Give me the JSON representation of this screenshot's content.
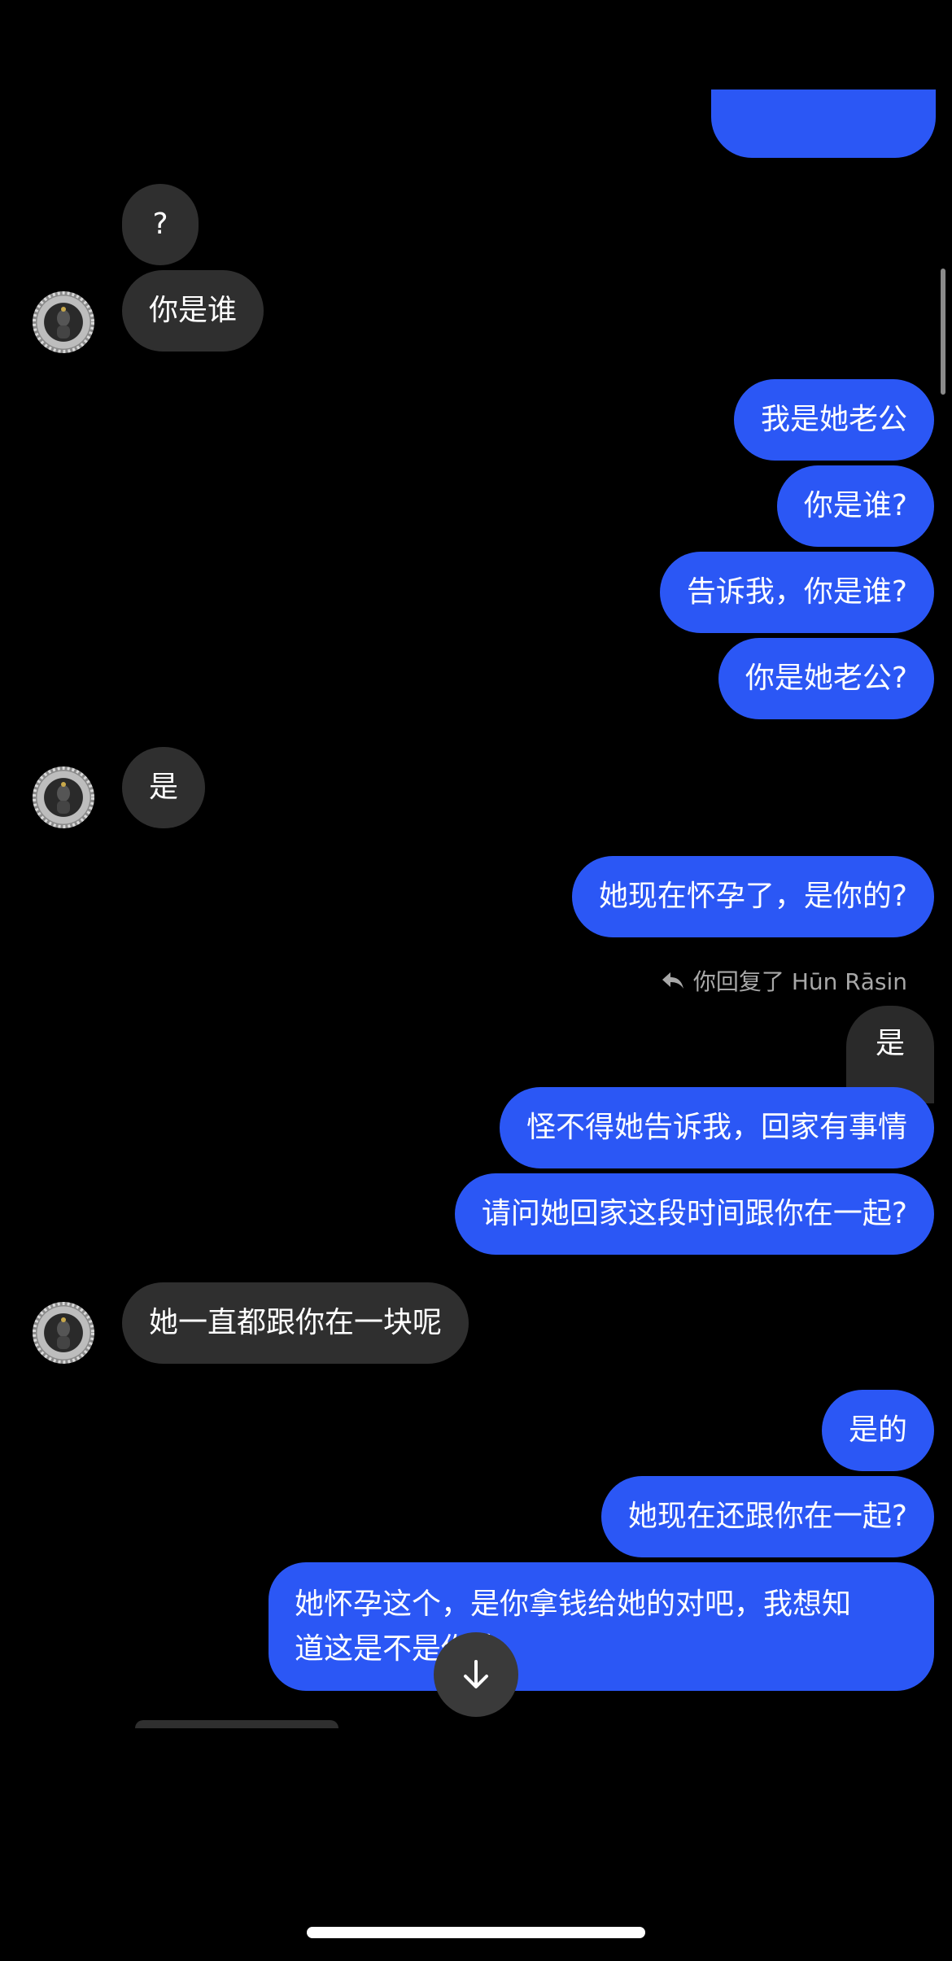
{
  "messages": {
    "m1": {
      "text": "?"
    },
    "m2": {
      "text": "你是谁"
    },
    "m3": {
      "text": "我是她老公"
    },
    "m4": {
      "text": "你是谁?"
    },
    "m5": {
      "text": "告诉我，你是谁?"
    },
    "m6": {
      "text": "你是她老公?"
    },
    "m7": {
      "text": "是"
    },
    "m8": {
      "text": "她现在怀孕了，是你的?"
    },
    "reply_note": "你回复了 Hūn Rāsin",
    "m9": {
      "text": "是"
    },
    "m10": {
      "text": "怪不得她告诉我，回家有事情"
    },
    "m11": {
      "text": "请问她回家这段时间跟你在一起?"
    },
    "m12": {
      "text": "她一直都跟你在一块呢"
    },
    "m13": {
      "text": "是的"
    },
    "m14": {
      "text": "她现在还跟你在一起?"
    },
    "m15": {
      "line1": "她怀孕这个，是你拿钱给她的对吧，我想知",
      "line2": "道这是不是你的"
    }
  },
  "icons": {
    "reply": "reply-arrow-icon",
    "scroll_down": "arrow-down-icon"
  },
  "colors": {
    "outgoing_bubble": "#2b57f5",
    "incoming_bubble": "#2f2f2f",
    "background": "#000000"
  }
}
